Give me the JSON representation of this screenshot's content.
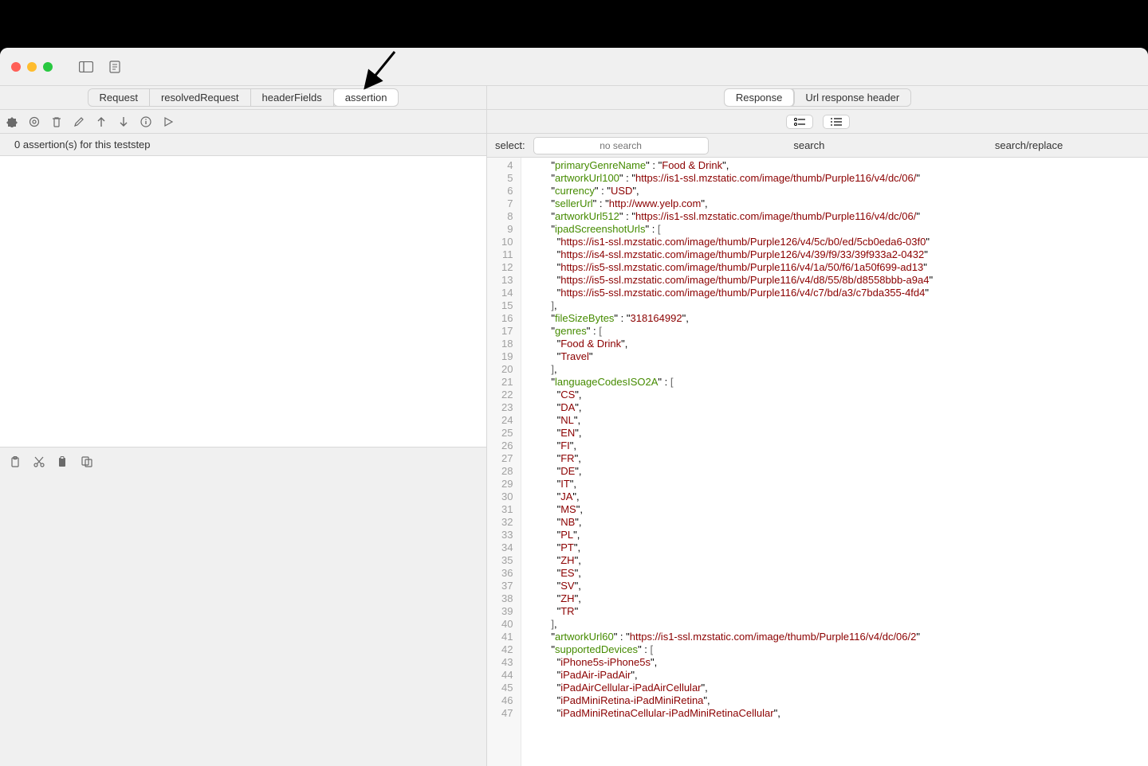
{
  "tabsLeft": {
    "request": "Request",
    "resolvedRequest": "resolvedRequest",
    "headerFields": "headerFields",
    "assertion": "assertion"
  },
  "tabsRight": {
    "response": "Response",
    "urlResponseHeader": "Url response header"
  },
  "assertionMessage": "0 assertion(s) for this teststep",
  "search": {
    "label": "select:",
    "placeholder": "no search",
    "search": "search",
    "searchReplace": "search/replace"
  },
  "code": {
    "startLine": 4,
    "tokens": [
      [
        [
          "ind",
          4
        ],
        [
          "key",
          "primaryGenreName"
        ],
        [
          "col",
          " : "
        ],
        [
          "str",
          "Food & Drink"
        ],
        [
          "p",
          ","
        ]
      ],
      [
        [
          "ind",
          4
        ],
        [
          "key",
          "artworkUrl100"
        ],
        [
          "col",
          " : "
        ],
        [
          "str",
          "https://is1-ssl.mzstatic.com/image/thumb/Purple116/v4/dc/06/"
        ],
        [
          "trunc",
          true
        ]
      ],
      [
        [
          "ind",
          4
        ],
        [
          "key",
          "currency"
        ],
        [
          "col",
          " : "
        ],
        [
          "str",
          "USD"
        ],
        [
          "p",
          ","
        ]
      ],
      [
        [
          "ind",
          4
        ],
        [
          "key",
          "sellerUrl"
        ],
        [
          "col",
          " : "
        ],
        [
          "str",
          "http://www.yelp.com"
        ],
        [
          "p",
          ","
        ]
      ],
      [
        [
          "ind",
          4
        ],
        [
          "key",
          "artworkUrl512"
        ],
        [
          "col",
          " : "
        ],
        [
          "str",
          "https://is1-ssl.mzstatic.com/image/thumb/Purple116/v4/dc/06/"
        ],
        [
          "trunc",
          true
        ]
      ],
      [
        [
          "ind",
          4
        ],
        [
          "key",
          "ipadScreenshotUrls"
        ],
        [
          "col",
          " : "
        ],
        [
          "brack",
          "["
        ]
      ],
      [
        [
          "ind",
          5
        ],
        [
          "str",
          "https://is1-ssl.mzstatic.com/image/thumb/Purple126/v4/5c/b0/ed/5cb0eda6-03f0"
        ],
        [
          "trunc",
          true
        ]
      ],
      [
        [
          "ind",
          5
        ],
        [
          "str",
          "https://is4-ssl.mzstatic.com/image/thumb/Purple126/v4/39/f9/33/39f933a2-0432"
        ],
        [
          "trunc",
          true
        ]
      ],
      [
        [
          "ind",
          5
        ],
        [
          "str",
          "https://is5-ssl.mzstatic.com/image/thumb/Purple116/v4/1a/50/f6/1a50f699-ad13"
        ],
        [
          "trunc",
          true
        ]
      ],
      [
        [
          "ind",
          5
        ],
        [
          "str",
          "https://is5-ssl.mzstatic.com/image/thumb/Purple116/v4/d8/55/8b/d8558bbb-a9a4"
        ],
        [
          "trunc",
          true
        ]
      ],
      [
        [
          "ind",
          5
        ],
        [
          "str",
          "https://is5-ssl.mzstatic.com/image/thumb/Purple116/v4/c7/bd/a3/c7bda355-4fd4"
        ],
        [
          "trunc",
          true
        ]
      ],
      [
        [
          "ind",
          4
        ],
        [
          "brack",
          "]"
        ],
        [
          "p",
          ","
        ]
      ],
      [
        [
          "ind",
          4
        ],
        [
          "key",
          "fileSizeBytes"
        ],
        [
          "col",
          " : "
        ],
        [
          "str",
          "318164992"
        ],
        [
          "p",
          ","
        ]
      ],
      [
        [
          "ind",
          4
        ],
        [
          "key",
          "genres"
        ],
        [
          "col",
          " : "
        ],
        [
          "brack",
          "["
        ]
      ],
      [
        [
          "ind",
          5
        ],
        [
          "str",
          "Food & Drink"
        ],
        [
          "p",
          ","
        ]
      ],
      [
        [
          "ind",
          5
        ],
        [
          "str",
          "Travel"
        ]
      ],
      [
        [
          "ind",
          4
        ],
        [
          "brack",
          "]"
        ],
        [
          "p",
          ","
        ]
      ],
      [
        [
          "ind",
          4
        ],
        [
          "key",
          "languageCodesISO2A"
        ],
        [
          "col",
          " : "
        ],
        [
          "brack",
          "["
        ]
      ],
      [
        [
          "ind",
          5
        ],
        [
          "str",
          "CS"
        ],
        [
          "p",
          ","
        ]
      ],
      [
        [
          "ind",
          5
        ],
        [
          "str",
          "DA"
        ],
        [
          "p",
          ","
        ]
      ],
      [
        [
          "ind",
          5
        ],
        [
          "str",
          "NL"
        ],
        [
          "p",
          ","
        ]
      ],
      [
        [
          "ind",
          5
        ],
        [
          "str",
          "EN"
        ],
        [
          "p",
          ","
        ]
      ],
      [
        [
          "ind",
          5
        ],
        [
          "str",
          "FI"
        ],
        [
          "p",
          ","
        ]
      ],
      [
        [
          "ind",
          5
        ],
        [
          "str",
          "FR"
        ],
        [
          "p",
          ","
        ]
      ],
      [
        [
          "ind",
          5
        ],
        [
          "str",
          "DE"
        ],
        [
          "p",
          ","
        ]
      ],
      [
        [
          "ind",
          5
        ],
        [
          "str",
          "IT"
        ],
        [
          "p",
          ","
        ]
      ],
      [
        [
          "ind",
          5
        ],
        [
          "str",
          "JA"
        ],
        [
          "p",
          ","
        ]
      ],
      [
        [
          "ind",
          5
        ],
        [
          "str",
          "MS"
        ],
        [
          "p",
          ","
        ]
      ],
      [
        [
          "ind",
          5
        ],
        [
          "str",
          "NB"
        ],
        [
          "p",
          ","
        ]
      ],
      [
        [
          "ind",
          5
        ],
        [
          "str",
          "PL"
        ],
        [
          "p",
          ","
        ]
      ],
      [
        [
          "ind",
          5
        ],
        [
          "str",
          "PT"
        ],
        [
          "p",
          ","
        ]
      ],
      [
        [
          "ind",
          5
        ],
        [
          "str",
          "ZH"
        ],
        [
          "p",
          ","
        ]
      ],
      [
        [
          "ind",
          5
        ],
        [
          "str",
          "ES"
        ],
        [
          "p",
          ","
        ]
      ],
      [
        [
          "ind",
          5
        ],
        [
          "str",
          "SV"
        ],
        [
          "p",
          ","
        ]
      ],
      [
        [
          "ind",
          5
        ],
        [
          "str",
          "ZH"
        ],
        [
          "p",
          ","
        ]
      ],
      [
        [
          "ind",
          5
        ],
        [
          "str",
          "TR"
        ]
      ],
      [
        [
          "ind",
          4
        ],
        [
          "brack",
          "]"
        ],
        [
          "p",
          ","
        ]
      ],
      [
        [
          "ind",
          4
        ],
        [
          "key",
          "artworkUrl60"
        ],
        [
          "col",
          " : "
        ],
        [
          "str",
          "https://is1-ssl.mzstatic.com/image/thumb/Purple116/v4/dc/06/2"
        ],
        [
          "trunc",
          true
        ]
      ],
      [
        [
          "ind",
          4
        ],
        [
          "key",
          "supportedDevices"
        ],
        [
          "col",
          " : "
        ],
        [
          "brack",
          "["
        ]
      ],
      [
        [
          "ind",
          5
        ],
        [
          "str",
          "iPhone5s-iPhone5s"
        ],
        [
          "p",
          ","
        ]
      ],
      [
        [
          "ind",
          5
        ],
        [
          "str",
          "iPadAir-iPadAir"
        ],
        [
          "p",
          ","
        ]
      ],
      [
        [
          "ind",
          5
        ],
        [
          "str",
          "iPadAirCellular-iPadAirCellular"
        ],
        [
          "p",
          ","
        ]
      ],
      [
        [
          "ind",
          5
        ],
        [
          "str",
          "iPadMiniRetina-iPadMiniRetina"
        ],
        [
          "p",
          ","
        ]
      ],
      [
        [
          "ind",
          5
        ],
        [
          "str",
          "iPadMiniRetinaCellular-iPadMiniRetinaCellular"
        ],
        [
          "p",
          ","
        ]
      ]
    ]
  }
}
